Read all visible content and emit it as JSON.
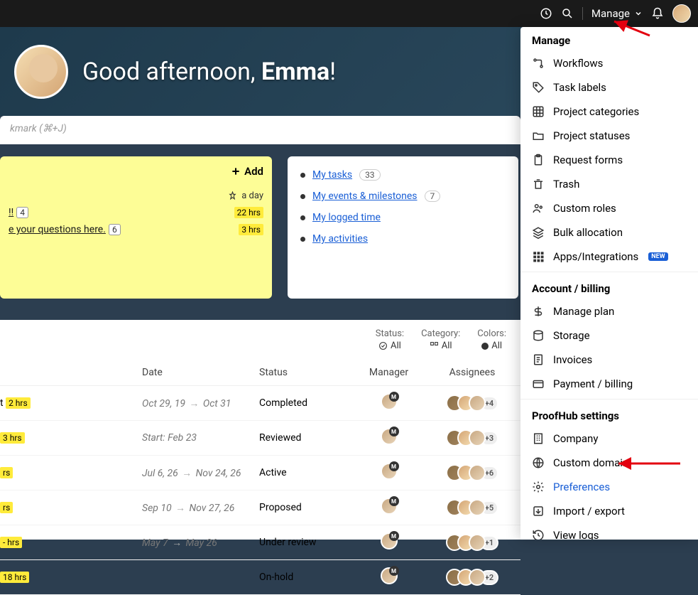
{
  "topbar": {
    "manage_label": "Manage"
  },
  "hero": {
    "greeting_prefix": "Good afternoon, ",
    "greeting_name": "Emma",
    "greeting_suffix": "!"
  },
  "search": {
    "placeholder": "kmark (⌘+J)"
  },
  "notes_card": {
    "add_label": "Add",
    "pin_label": "a day",
    "rows": [
      {
        "text": "!!",
        "count": "4",
        "hrs": "22 hrs"
      },
      {
        "text": "e your questions here.",
        "count": "6",
        "hrs": "3 hrs"
      }
    ]
  },
  "links_card": {
    "items": [
      {
        "label": "My tasks",
        "badge": "33"
      },
      {
        "label": "My events & milestones",
        "badge": "7"
      },
      {
        "label": "My logged time",
        "badge": ""
      },
      {
        "label": "My activities",
        "badge": ""
      }
    ]
  },
  "filters": {
    "status_label": "Status:",
    "status_value": "All",
    "category_label": "Category:",
    "category_value": "All",
    "colors_label": "Colors:",
    "colors_value": "All"
  },
  "table": {
    "headers": {
      "date": "Date",
      "status": "Status",
      "manager": "Manager",
      "assignees": "Assignees"
    },
    "rows": [
      {
        "tag_hrs": "2 hrs",
        "tag_prefix": "t",
        "date_a": "Oct 29, 19",
        "date_b": "Oct 31",
        "status": "Completed",
        "more": "+4"
      },
      {
        "tag_hrs": "3 hrs",
        "tag_prefix": "",
        "date_a": "Start: Feb 23",
        "date_b": "",
        "status": "Reviewed",
        "more": "+3"
      },
      {
        "tag_hrs": "rs",
        "tag_prefix": "",
        "date_a": "Jul 6, 26",
        "date_b": "Nov 24, 26",
        "status": "Active",
        "more": "+6"
      },
      {
        "tag_hrs": "rs",
        "tag_prefix": "",
        "date_a": "Sep 10",
        "date_b": "Nov 27, 26",
        "status": "Proposed",
        "more": "+5"
      },
      {
        "tag_hrs": "‑ hrs",
        "tag_prefix": "",
        "date_a": "May 7",
        "date_b": "May 26",
        "status": "Under review",
        "more": "+1"
      },
      {
        "tag_hrs": "18 hrs",
        "tag_prefix": "",
        "date_a": "",
        "date_b": "",
        "status": "On-hold",
        "more": "+2"
      }
    ]
  },
  "dropdown": {
    "sections": [
      {
        "header": "Manage",
        "items": [
          {
            "icon": "workflow",
            "label": "Workflows"
          },
          {
            "icon": "tag",
            "label": "Task labels"
          },
          {
            "icon": "grid",
            "label": "Project categories"
          },
          {
            "icon": "folder",
            "label": "Project statuses"
          },
          {
            "icon": "clipboard",
            "label": "Request forms"
          },
          {
            "icon": "trash",
            "label": "Trash"
          },
          {
            "icon": "roles",
            "label": "Custom roles"
          },
          {
            "icon": "layers",
            "label": "Bulk allocation"
          },
          {
            "icon": "apps",
            "label": "Apps/Integrations",
            "new": "NEW"
          }
        ]
      },
      {
        "header": "Account / billing",
        "items": [
          {
            "icon": "dollar",
            "label": "Manage plan"
          },
          {
            "icon": "storage",
            "label": "Storage"
          },
          {
            "icon": "invoice",
            "label": "Invoices"
          },
          {
            "icon": "card",
            "label": "Payment / billing"
          }
        ]
      },
      {
        "header": "ProofHub settings",
        "items": [
          {
            "icon": "building",
            "label": "Company"
          },
          {
            "icon": "globe",
            "label": "Custom domain"
          },
          {
            "icon": "gear",
            "label": "Preferences",
            "highlighted": true
          },
          {
            "icon": "import",
            "label": "Import / export"
          },
          {
            "icon": "history",
            "label": "View logs"
          }
        ]
      }
    ]
  }
}
